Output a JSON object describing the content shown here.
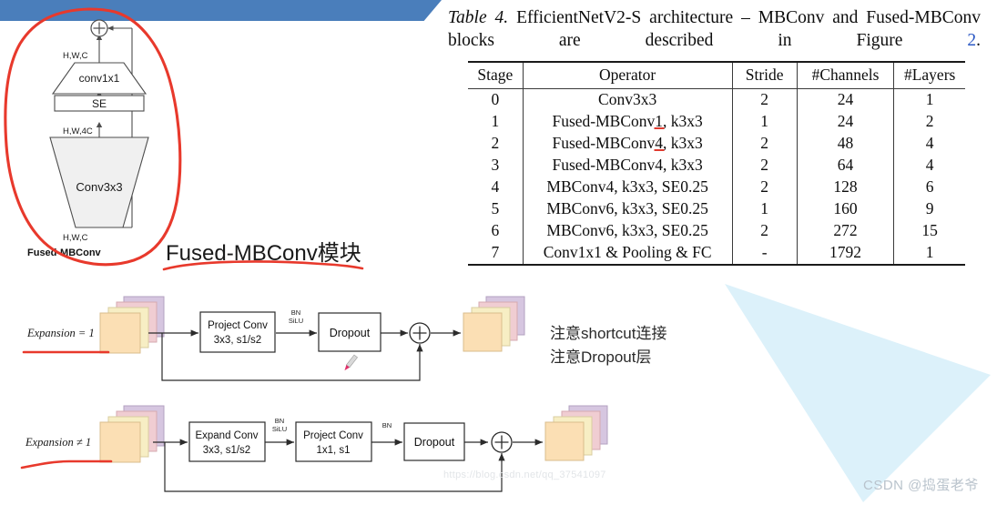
{
  "banner": {
    "color": "#4a7ebb"
  },
  "annotations": {
    "red_color": "#e8392c",
    "circle_label": "red-circle-around-fused-mbconv-diagram",
    "fused_title": "Fused-MBConv模块"
  },
  "left_figure": {
    "name": "Fused-MBConv block diagram",
    "caption": "Fused-MBConv",
    "nodes": [
      {
        "id": "conv1x1",
        "label": "conv1x1",
        "shape": "trapezoid-up",
        "fill": "#ffffff"
      },
      {
        "id": "se",
        "label": "SE",
        "shape": "rect",
        "fill": "#ffffff"
      },
      {
        "id": "conv3x3",
        "label": "Conv3x3",
        "shape": "trapezoid-down",
        "fill": "#f1f1f1"
      }
    ],
    "tensor_labels": [
      "H,W,C",
      "H,W,4C",
      "H,W,C"
    ],
    "add_symbol": "+"
  },
  "table": {
    "caption_parts": {
      "italic": "Table 4.",
      "rest": " EfficientNetV2-S architecture – MBConv and Fused-MBConv blocks are described in Figure ",
      "link": "2",
      "end": "."
    },
    "caption_line1": "Table 4. EfficientNetV2-S  architecture  –  MBConv  and  Fused-",
    "caption_line2": "MBConv blocks are described in Figure 2.",
    "headers": [
      "Stage",
      "Operator",
      "Stride",
      "#Channels",
      "#Layers"
    ],
    "rows": [
      {
        "stage": "0",
        "operator": "Conv3x3",
        "op_pre": "Conv3x3",
        "op_mark": "",
        "op_post": "",
        "stride": "2",
        "channels": "24",
        "layers": "1"
      },
      {
        "stage": "1",
        "operator": "Fused-MBConv1, k3x3",
        "op_pre": "Fused-MBConv",
        "op_mark": "1",
        "op_post": ", k3x3",
        "stride": "1",
        "channels": "24",
        "layers": "2"
      },
      {
        "stage": "2",
        "operator": "Fused-MBConv4, k3x3",
        "op_pre": "Fused-MBConv",
        "op_mark": "4",
        "op_post": ", k3x3",
        "stride": "2",
        "channels": "48",
        "layers": "4"
      },
      {
        "stage": "3",
        "operator": "Fused-MBConv4, k3x3",
        "op_pre": "Fused-MBConv4, k3x3",
        "op_mark": "",
        "op_post": "",
        "stride": "2",
        "channels": "64",
        "layers": "4"
      },
      {
        "stage": "4",
        "operator": "MBConv4, k3x3, SE0.25",
        "op_pre": "MBConv4, k3x3, SE0.25",
        "op_mark": "",
        "op_post": "",
        "stride": "2",
        "channels": "128",
        "layers": "6"
      },
      {
        "stage": "5",
        "operator": "MBConv6, k3x3, SE0.25",
        "op_pre": "MBConv6, k3x3, SE0.25",
        "op_mark": "",
        "op_post": "",
        "stride": "1",
        "channels": "160",
        "layers": "9"
      },
      {
        "stage": "6",
        "operator": "MBConv6, k3x3, SE0.25",
        "op_pre": "MBConv6, k3x3, SE0.25",
        "op_mark": "",
        "op_post": "",
        "stride": "2",
        "channels": "272",
        "layers": "15"
      },
      {
        "stage": "7",
        "operator": "Conv1x1 & Pooling & FC",
        "op_pre": "Conv1x1 & Pooling & FC",
        "op_mark": "",
        "op_post": "",
        "stride": "-",
        "channels": "1792",
        "layers": "1"
      }
    ]
  },
  "mid_figure": {
    "name": "Fused-MBConv expansion equals 1 flow",
    "expansion_label": "Expansion = 1",
    "blocks": [
      {
        "line1": "Project Conv",
        "line2": "3x3, s1/s2"
      },
      {
        "line1": "Dropout",
        "line2": ""
      }
    ],
    "edge_labels": [
      {
        "line1": "BN",
        "line2": "SiLU"
      }
    ],
    "add_symbol": "+",
    "stack_colors": [
      "#d6c6e0",
      "#f0cdd2",
      "#f7eec4",
      "#fbdfb4"
    ]
  },
  "bot_figure": {
    "name": "Fused-MBConv expansion not equal 1 flow",
    "expansion_label": "Expansion ≠ 1",
    "blocks": [
      {
        "line1": "Expand Conv",
        "line2": "3x3, s1/s2"
      },
      {
        "line1": "Project Conv",
        "line2": "1x1, s1"
      },
      {
        "line1": "Dropout",
        "line2": ""
      }
    ],
    "edge_labels": [
      {
        "line1": "BN",
        "line2": "SiLU"
      },
      {
        "line1": "BN",
        "line2": ""
      }
    ],
    "add_symbol": "+",
    "stack_colors": [
      "#d6c6e0",
      "#f0cdd2",
      "#f7eec4",
      "#fbdfb4"
    ]
  },
  "notes": {
    "line1": "注意shortcut连接",
    "line2": "注意Dropout层"
  },
  "watermarks": {
    "csdn": "CSDN @捣蛋老爷",
    "url": "https://blog.csdn.net/qq_37541097"
  }
}
